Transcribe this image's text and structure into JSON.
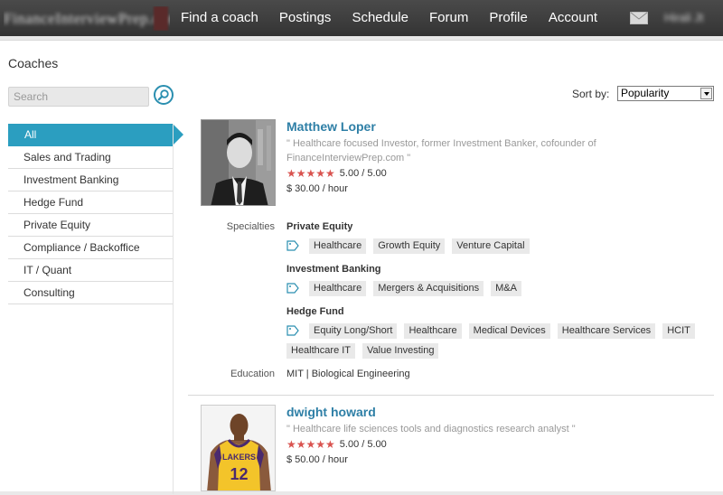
{
  "brand": {
    "name": "FinanceInterviewPrep.com"
  },
  "nav": [
    {
      "label": "Find a coach"
    },
    {
      "label": "Postings"
    },
    {
      "label": "Schedule"
    },
    {
      "label": "Forum"
    },
    {
      "label": "Profile"
    },
    {
      "label": "Account"
    }
  ],
  "user": {
    "name": "Hirali Jt"
  },
  "sidebar": {
    "title": "Coaches",
    "search_placeholder": "Search",
    "categories": [
      {
        "label": "All",
        "active": true
      },
      {
        "label": "Sales and Trading"
      },
      {
        "label": "Investment Banking"
      },
      {
        "label": "Hedge Fund"
      },
      {
        "label": "Private Equity"
      },
      {
        "label": "Compliance / Backoffice"
      },
      {
        "label": "IT / Quant"
      },
      {
        "label": "Consulting"
      }
    ]
  },
  "sort": {
    "label": "Sort by:",
    "selected": "Popularity"
  },
  "labels": {
    "specialties": "Specialties",
    "education": "Education"
  },
  "coaches": [
    {
      "name": "Matthew Loper",
      "quote": "\" Healthcare focused Investor, former Investment Banker, cofounder of FinanceInterviewPrep.com \"",
      "stars": "★★★★★",
      "rating": "5.00 / 5.00",
      "price": "$ 30.00 / hour",
      "specialties": [
        {
          "title": "Private Equity",
          "tags": [
            "Healthcare",
            "Growth Equity",
            "Venture Capital"
          ]
        },
        {
          "title": "Investment Banking",
          "tags": [
            "Healthcare",
            "Mergers & Acquisitions",
            "M&A"
          ]
        },
        {
          "title": "Hedge Fund",
          "tags": [
            "Equity Long/Short",
            "Healthcare",
            "Medical Devices",
            "Healthcare Services",
            "HCIT",
            "Healthcare IT",
            "Value Investing"
          ]
        }
      ],
      "education": "MIT | Biological Engineering"
    },
    {
      "name": "dwight howard",
      "quote": "\" Healthcare life sciences tools and diagnostics research analyst  \"",
      "stars": "★★★★★",
      "rating": "5.00 / 5.00",
      "price": "$ 50.00 / hour",
      "jersey": {
        "team": "LAKERS",
        "number": "12"
      }
    }
  ]
}
